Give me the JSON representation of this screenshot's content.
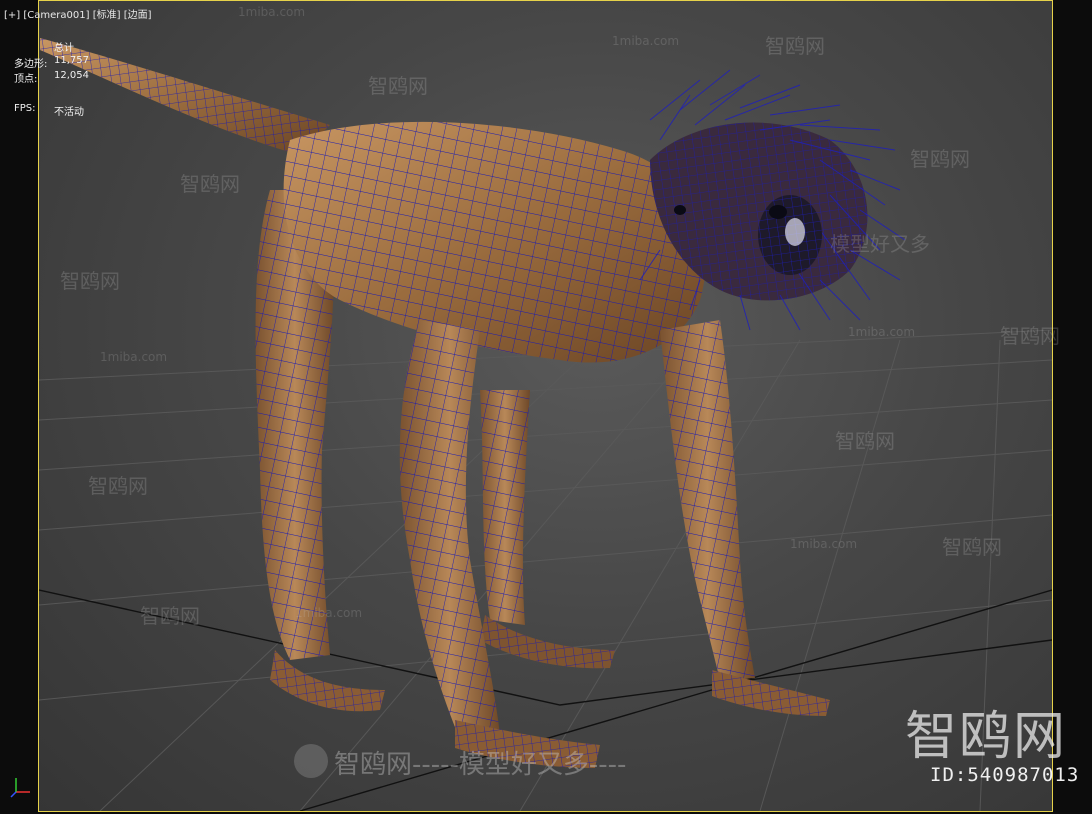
{
  "viewport": {
    "menu_plus": "[+]",
    "camera": "[Camera001]",
    "shading": "[标准]",
    "edges": "[边面]"
  },
  "stats": {
    "total_label": "总计",
    "polygons_label": "多边形:",
    "polygons_value": "11,757",
    "vertices_label": "顶点:",
    "vertices_value": "12,054",
    "fps_label": "FPS:",
    "fps_value": "不活动"
  },
  "watermarks": {
    "site_cn": "智鸥网",
    "site_en": "1miba.com",
    "slogan": "模型好又多",
    "brand_big": "智鸥网",
    "id_text": "ID:540987013",
    "bottom": "智鸥网-----模型好又多----"
  },
  "colors": {
    "wire": "#1a1aa8",
    "skin": "#a8784a",
    "frame": "#e6d24a"
  },
  "icons": [
    "axis-gizmo-icon",
    "watermark-bird-icon"
  ]
}
